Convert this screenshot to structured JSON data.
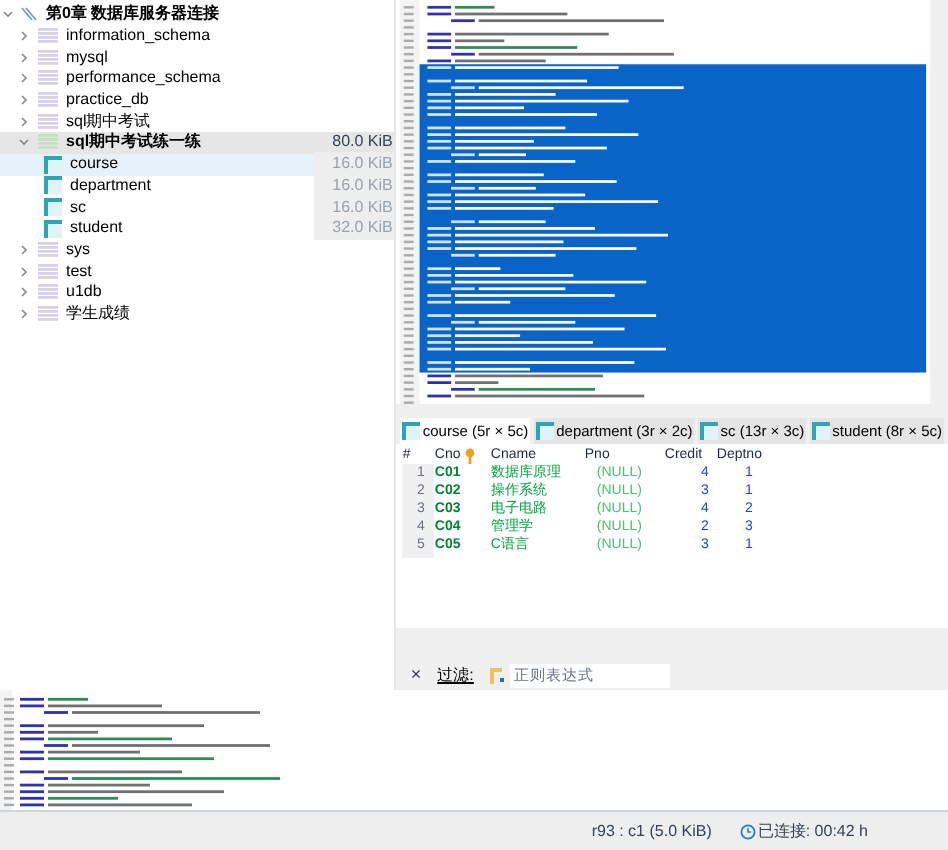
{
  "tree": {
    "label": "第0章 数据库服务器连接",
    "expanded": true,
    "children": [
      {
        "label": "information_schema",
        "expanded": false,
        "active": false
      },
      {
        "label": "mysql",
        "expanded": false,
        "active": false
      },
      {
        "label": "performance_schema",
        "expanded": false,
        "active": false
      },
      {
        "label": "practice_db",
        "expanded": false,
        "active": false
      },
      {
        "label": "sql期中考试",
        "expanded": false,
        "active": false
      },
      {
        "label": "sql期中考试练一练",
        "expanded": true,
        "active": true,
        "size": "80.0 KiB",
        "children": [
          {
            "label": "course",
            "size": "16.0 KiB",
            "selected": true
          },
          {
            "label": "department",
            "size": "16.0 KiB",
            "selected": false
          },
          {
            "label": "sc",
            "size": "16.0 KiB",
            "selected": false
          },
          {
            "label": "student",
            "size": "32.0 KiB",
            "selected": false
          }
        ]
      },
      {
        "label": "sys",
        "expanded": false,
        "active": false
      },
      {
        "label": "test",
        "expanded": false,
        "active": false
      },
      {
        "label": "u1db",
        "expanded": false,
        "active": false
      },
      {
        "label": "学生成绩",
        "expanded": false,
        "active": false
      }
    ]
  },
  "result_tabs": [
    {
      "label": "course (5r × 5c)",
      "selected": true
    },
    {
      "label": "department (3r × 2c)",
      "selected": false
    },
    {
      "label": "sc (13r × 3c)",
      "selected": false
    },
    {
      "label": "student (8r × 5c)",
      "selected": false
    }
  ],
  "table": {
    "columns": [
      "#",
      "Cno",
      "Cname",
      "Pno",
      "Credit",
      "Deptno"
    ],
    "rows": [
      [
        "1",
        "C01",
        "数据库原理",
        "(NULL)",
        "4",
        "1"
      ],
      [
        "2",
        "C02",
        "操作系统",
        "(NULL)",
        "3",
        "1"
      ],
      [
        "3",
        "C03",
        "电子电路",
        "(NULL)",
        "4",
        "2"
      ],
      [
        "4",
        "C04",
        "管理学",
        "(NULL)",
        "2",
        "3"
      ],
      [
        "5",
        "C05",
        "C语言",
        "(NULL)",
        "3",
        "1"
      ]
    ]
  },
  "filter": {
    "close": "×",
    "label": "过滤:",
    "placeholder": "正则表达式"
  },
  "status_bar": {
    "position": "r93 : c1 (5.0 KiB)",
    "connected": "已连接: 00:42 h"
  }
}
